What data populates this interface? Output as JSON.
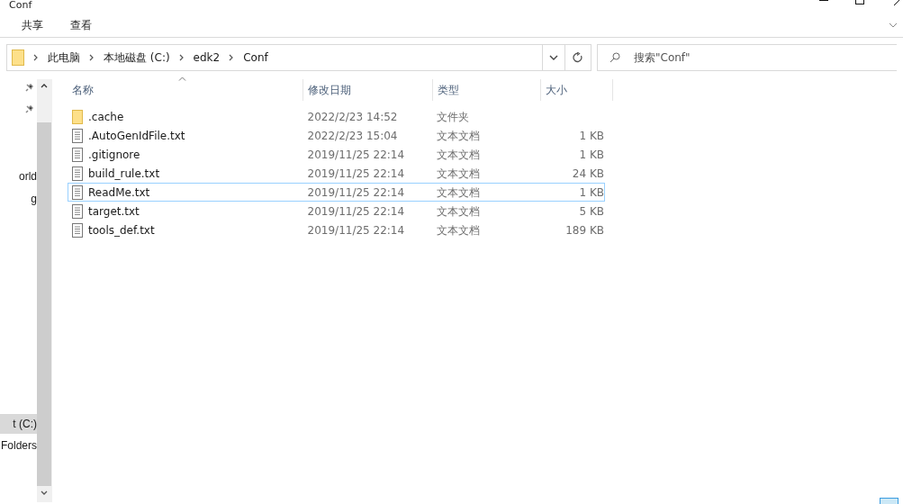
{
  "window": {
    "title": "Conf"
  },
  "ribbon_tabs": [
    {
      "label": "共享"
    },
    {
      "label": "查看"
    }
  ],
  "address_bar": {
    "path": [
      "此电脑",
      "本地磁盘 (C:)",
      "edk2",
      "Conf"
    ]
  },
  "search": {
    "placeholder": "搜索\"Conf\""
  },
  "nav_pane": {
    "items": [
      {
        "label": "orld",
        "selected": false
      },
      {
        "label": "g",
        "selected": false
      },
      {
        "label": "t (C:)",
        "selected": true
      },
      {
        "label": "Folders",
        "selected": false
      }
    ]
  },
  "table": {
    "columns": [
      "名称",
      "修改日期",
      "类型",
      "大小"
    ],
    "rows": [
      {
        "kind": "folder",
        "name": ".cache",
        "date": "2022/2/23 14:52",
        "type": "文件夹",
        "focused": false
      },
      {
        "kind": "file",
        "name": ".AutoGenIdFile.txt",
        "date": "2022/2/23 15:04",
        "type": "文本文档",
        "size": "1 KB",
        "focused": false
      },
      {
        "kind": "file",
        "name": ".gitignore",
        "date": "2019/11/25 22:14",
        "type": "文本文档",
        "size": "1 KB",
        "focused": false
      },
      {
        "kind": "file",
        "name": "build_rule.txt",
        "date": "2019/11/25 22:14",
        "type": "文本文档",
        "size": "24 KB",
        "focused": false
      },
      {
        "kind": "file",
        "name": "ReadMe.txt",
        "date": "2019/11/25 22:14",
        "type": "文本文档",
        "size": "1 KB",
        "focused": true
      },
      {
        "kind": "file",
        "name": "target.txt",
        "date": "2019/11/25 22:14",
        "type": "文本文档",
        "size": "5 KB",
        "focused": false
      },
      {
        "kind": "file",
        "name": "tools_def.txt",
        "date": "2019/11/25 22:14",
        "type": "文本文档",
        "size": "189 KB",
        "focused": false
      }
    ]
  }
}
